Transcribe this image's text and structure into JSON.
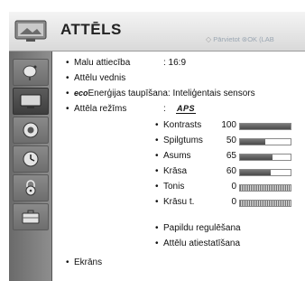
{
  "header": {
    "title": "ATTĒLS",
    "hint": "Pārvietot ⊛OK (LAB"
  },
  "sidebar": {
    "items": [
      {
        "icon": "satellite-dish-icon"
      },
      {
        "icon": "tv-picture-icon",
        "active": true
      },
      {
        "icon": "speaker-icon"
      },
      {
        "icon": "clock-icon"
      },
      {
        "icon": "lock-icon"
      },
      {
        "icon": "suitcase-icon"
      }
    ]
  },
  "menu": {
    "aspect_label": "Malu attiecība",
    "aspect_value": ": 16:9",
    "wizard_label": "Attēlu vednis",
    "eco_prefix": "eco",
    "eco_label": "Enerģijas taupīšana: Inteliģentais sensors",
    "mode_label": "Attēla režīms",
    "mode_sep": ":",
    "mode_value": "APS",
    "screen_label": "Ekrāns",
    "advanced_label": "Papildu regulēšana",
    "reset_label": "Attēlu atiestatīšana"
  },
  "settings": [
    {
      "label": "Kontrasts",
      "value": "100",
      "level": 1.0,
      "style": "solid"
    },
    {
      "label": "Spilgtums",
      "value": "50",
      "level": 0.5,
      "style": "solid"
    },
    {
      "label": "Asums",
      "value": "65",
      "level": 0.65,
      "style": "solid"
    },
    {
      "label": "Krāsa",
      "value": "60",
      "level": 0.6,
      "style": "solid"
    },
    {
      "label": "Tonis",
      "value": "0",
      "level": 0,
      "style": "hatched"
    },
    {
      "label": "Krāsu t.",
      "value": "0",
      "level": 0,
      "style": "hatched"
    }
  ],
  "bullet_char": "•"
}
